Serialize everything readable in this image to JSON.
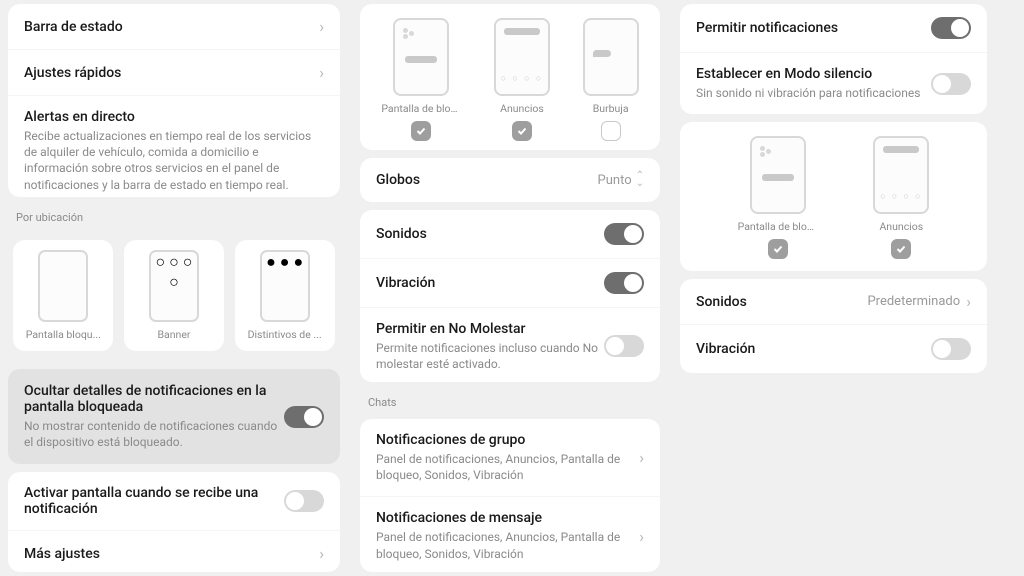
{
  "col1": {
    "items": [
      {
        "title": "Barra de estado"
      },
      {
        "title": "Ajustes rápidos"
      },
      {
        "title": "Alertas en directo",
        "subtitle": "Recibe actualizaciones en tiempo real de los servicios de alquiler de vehículo, comida a domicilio e información sobre otros servicios en el panel de notificaciones y la barra de estado en tiempo real."
      }
    ],
    "locationLabel": "Por ubicación",
    "thumbs": [
      "Pantalla bloqu...",
      "Banner",
      "Distintivos de ..."
    ],
    "hide": {
      "title": "Ocultar detalles de notificaciones en la pantalla bloqueada",
      "subtitle": "No mostrar contenido de notificaciones cuando el dispositivo está bloqueado."
    },
    "wake": {
      "title": "Activar pantalla cuando se recibe una notificación"
    },
    "more": {
      "title": "Más ajustes"
    }
  },
  "col2": {
    "thumbs": [
      "Pantalla de bloqueo",
      "Anuncios",
      "Burbuja"
    ],
    "thumbChecks": [
      true,
      true,
      false
    ],
    "globos": {
      "title": "Globos",
      "value": "Punto"
    },
    "sounds": {
      "title": "Sonidos"
    },
    "vibration": {
      "title": "Vibración"
    },
    "dnd": {
      "title": "Permitir en No Molestar",
      "subtitle": "Permite notificaciones incluso cuando No molestar esté activado."
    },
    "chatsLabel": "Chats",
    "group": {
      "title": "Notificaciones de grupo",
      "subtitle": "Panel de notificaciones, Anuncios, Pantalla de bloqueo, Sonidos, Vibración"
    },
    "message": {
      "title": "Notificaciones de mensaje",
      "subtitle": "Panel de notificaciones, Anuncios, Pantalla de bloqueo, Sonidos, Vibración"
    }
  },
  "col3": {
    "allow": {
      "title": "Permitir notificaciones"
    },
    "silent": {
      "title": "Establecer en Modo silencio",
      "subtitle": "Sin sonido ni vibración para notificaciones"
    },
    "thumbs": [
      "Pantalla de bloqueo",
      "Anuncios"
    ],
    "sounds": {
      "title": "Sonidos",
      "value": "Predeterminado"
    },
    "vibration": {
      "title": "Vibración"
    }
  }
}
